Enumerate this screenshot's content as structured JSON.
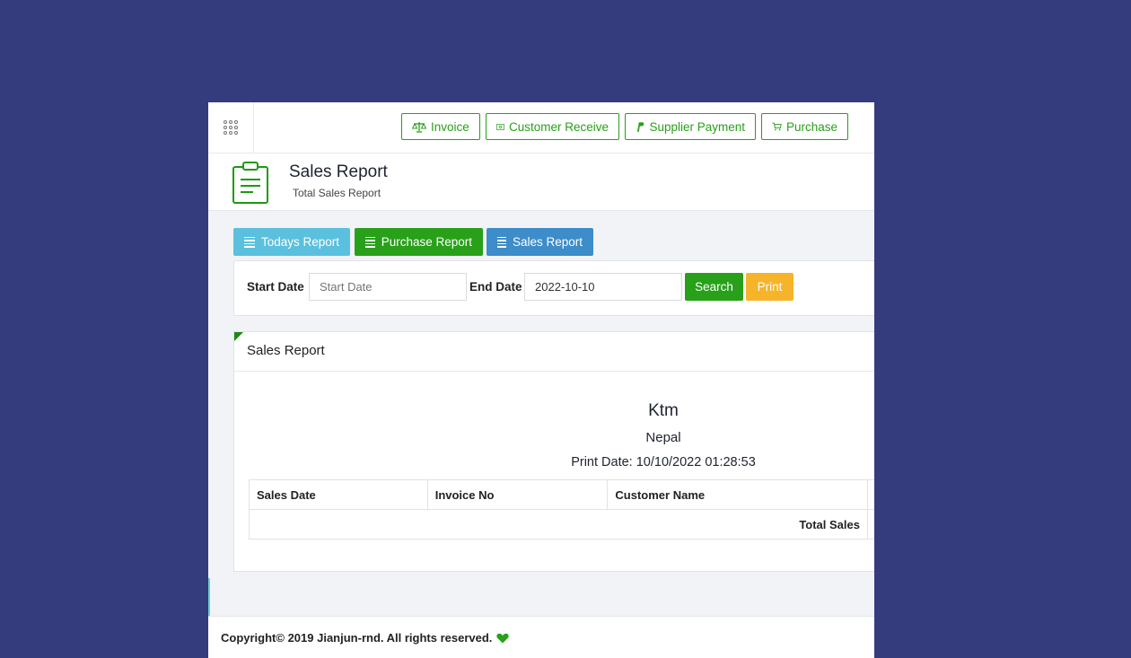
{
  "topbar": {
    "quick_links": [
      {
        "label": "Invoice",
        "icon": "balance-scale-icon"
      },
      {
        "label": "Customer Receive",
        "icon": "money-icon"
      },
      {
        "label": "Supplier Payment",
        "icon": "paypal-icon"
      },
      {
        "label": "Purchase",
        "icon": "cart-icon"
      }
    ]
  },
  "header": {
    "title": "Sales Report",
    "subtitle": "Total Sales Report"
  },
  "tabs": [
    {
      "label": "Todays Report",
      "color": "#5bc0de"
    },
    {
      "label": "Purchase Report",
      "color": "#28a019"
    },
    {
      "label": "Sales Report",
      "color": "#3c8dc9"
    }
  ],
  "filter": {
    "start_label": "Start Date",
    "start_placeholder": "Start Date",
    "end_label": "End Date",
    "end_value": "2022-10-10",
    "search_label": "Search",
    "print_label": "Print"
  },
  "report": {
    "panel_title": "Sales Report",
    "company_name": "Ktm",
    "company_address": "Nepal",
    "print_date": "Print Date: 10/10/2022 01:28:53",
    "columns": [
      "Sales Date",
      "Invoice No",
      "Customer Name"
    ],
    "total_label": "Total Sales"
  },
  "footer": {
    "copyright": "Copyright© 2019 Jianjun-rnd. All rights reserved."
  },
  "colors": {
    "background": "#343c7e",
    "accent_green": "#28a019",
    "print_orange": "#f6b42a"
  }
}
